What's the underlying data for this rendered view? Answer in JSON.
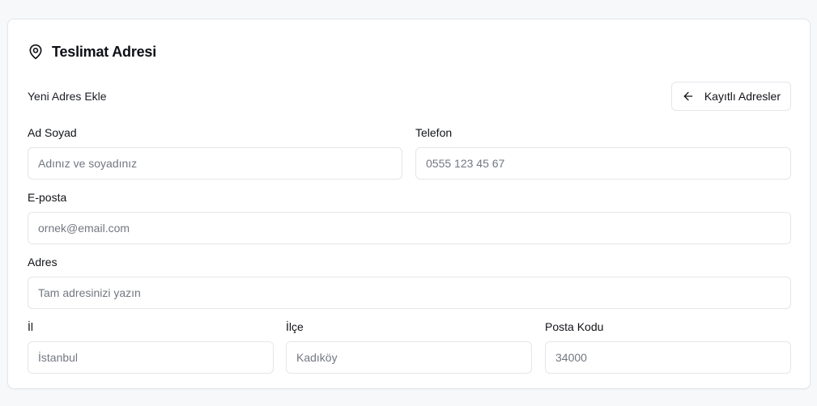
{
  "card": {
    "title": "Teslimat Adresi",
    "icon": "map-pin-icon"
  },
  "subhead": {
    "title": "Yeni Adres Ekle",
    "saved_button_label": "Kayıtlı Adresler",
    "saved_button_icon": "arrow-left-icon"
  },
  "fields": {
    "name": {
      "label": "Ad Soyad",
      "placeholder": "Adınız ve soyadınız",
      "value": ""
    },
    "phone": {
      "label": "Telefon",
      "placeholder": "0555 123 45 67",
      "value": ""
    },
    "email": {
      "label": "E-posta",
      "placeholder": "ornek@email.com",
      "value": ""
    },
    "address": {
      "label": "Adres",
      "placeholder": "Tam adresinizi yazın",
      "value": ""
    },
    "city": {
      "label": "İl",
      "placeholder": "İstanbul",
      "value": ""
    },
    "district": {
      "label": "İlçe",
      "placeholder": "Kadıköy",
      "value": ""
    },
    "postal": {
      "label": "Posta Kodu",
      "placeholder": "34000",
      "value": ""
    }
  }
}
